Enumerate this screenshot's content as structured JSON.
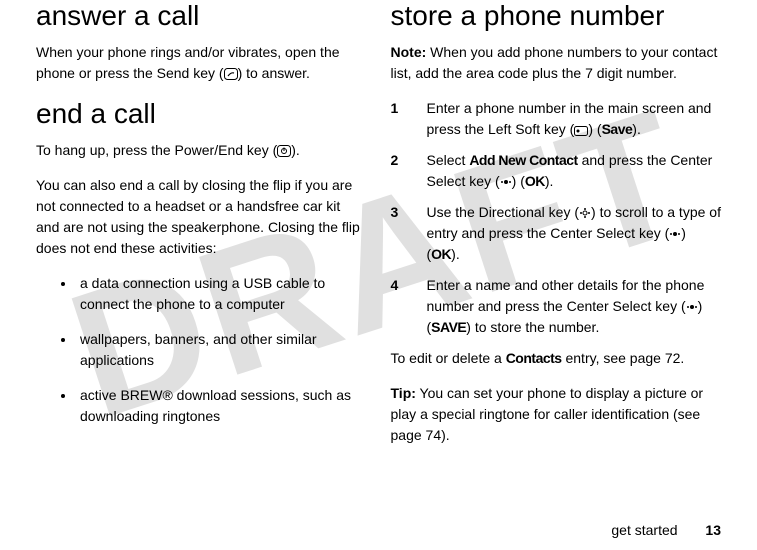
{
  "watermark": "DRAFT",
  "left": {
    "h1": "answer a call",
    "p1a": "When your phone rings and/or vibrates, open the phone or press the Send key (",
    "p1b": ") to answer.",
    "h2": "end a call",
    "p2a": "To hang up, press the Power/End key (",
    "p2b": ").",
    "p3": "You can also end a call by closing the flip if you are not connected to a headset or a handsfree car kit and are not using the speakerphone. Closing the flip does not end these activities:",
    "b1": "a data connection using a USB cable to connect the phone to a computer",
    "b2": "wallpapers, banners, and other similar applications",
    "b3": "active BREW® download sessions, such as downloading ringtones"
  },
  "right": {
    "h1": "store a phone number",
    "noteLabel": "Note:",
    "noteText": " When you add phone numbers to your contact list, add the area code plus the 7 digit number.",
    "s1a": "Enter a phone number in the main screen and press the Left Soft key (",
    "s1b": ") (",
    "s1save": "Save",
    "s1c": ").",
    "s2a": "Select ",
    "s2add": "Add New Contact",
    "s2b": " and press the Center Select key (",
    "s2c": ") (",
    "s2ok": "OK",
    "s2d": ").",
    "s3a": "Use the Directional key (",
    "s3b": ") to scroll to a type of entry and press the Center Select key (",
    "s3c": ") (",
    "s3ok": "OK",
    "s3d": ").",
    "s4a": "Enter a name and other details for the phone number and press the Center Select key (",
    "s4b": ") (",
    "s4save": "SAVE",
    "s4c": ") to store the number.",
    "p_edit_a": "To edit or delete a ",
    "p_edit_contacts": "Contacts",
    "p_edit_b": " entry, see page 72.",
    "tipLabel": "Tip:",
    "tipText": " You can set your phone to display a picture or play a special ringtone for caller identification (see page 74)."
  },
  "footer": {
    "section": "get started",
    "page": "13"
  }
}
